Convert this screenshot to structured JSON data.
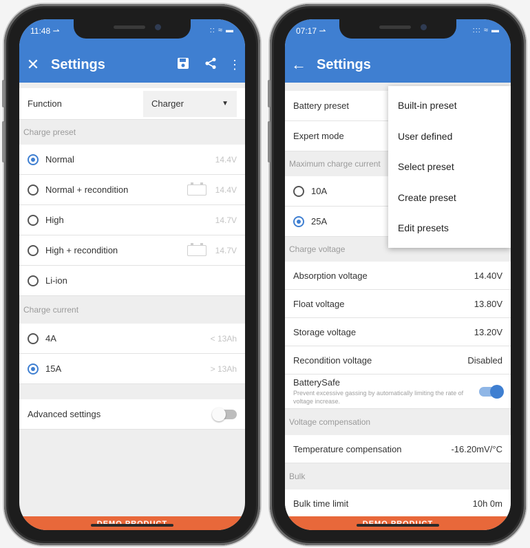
{
  "left": {
    "status": {
      "time": "11:48 ⇀",
      "icons": "::  ≈ ▬"
    },
    "title": "Settings",
    "function": {
      "label": "Function",
      "value": "Charger"
    },
    "charge_preset": {
      "header": "Charge preset",
      "items": [
        {
          "label": "Normal",
          "value": "14.4V",
          "selected": true,
          "battery": false
        },
        {
          "label": "Normal + recondition",
          "value": "14.4V",
          "selected": false,
          "battery": true
        },
        {
          "label": "High",
          "value": "14.7V",
          "selected": false,
          "battery": false
        },
        {
          "label": "High  + recondition",
          "value": "14.7V",
          "selected": false,
          "battery": true
        },
        {
          "label": "Li-ion",
          "value": "",
          "selected": false,
          "battery": false
        }
      ]
    },
    "charge_current": {
      "header": "Charge current",
      "items": [
        {
          "label": "4A",
          "value": "< 13Ah",
          "selected": false
        },
        {
          "label": "15A",
          "value": "> 13Ah",
          "selected": true
        }
      ]
    },
    "advanced": {
      "label": "Advanced settings",
      "enabled": false
    },
    "footer": "DEMO PRODUCT"
  },
  "right": {
    "status": {
      "time": "07:17 ⇀",
      "icons": "::: ≈ ▬"
    },
    "title": "Settings",
    "battery_preset": "Battery preset",
    "expert_mode": "Expert mode",
    "max_current": {
      "header": "Maximum charge current",
      "items": [
        {
          "label": "10A",
          "selected": false
        },
        {
          "label": "25A",
          "selected": true
        }
      ]
    },
    "charge_voltage": {
      "header": "Charge voltage",
      "absorption": {
        "label": "Absorption voltage",
        "value": "14.40V"
      },
      "float": {
        "label": "Float voltage",
        "value": "13.80V"
      },
      "storage": {
        "label": "Storage voltage",
        "value": "13.20V"
      },
      "recondition": {
        "label": "Recondition voltage",
        "value": "Disabled"
      },
      "batterysafe": {
        "label": "BatterySafe",
        "desc": "Prevent excessive gassing by automatically limiting the rate of voltage increase.",
        "enabled": true
      }
    },
    "voltage_comp": {
      "header": "Voltage compensation",
      "temp": {
        "label": "Temperature compensation",
        "value": "-16.20mV/°C"
      }
    },
    "bulk": {
      "header": "Bulk",
      "time_limit": {
        "label": "Bulk time limit",
        "value": "10h 0m"
      }
    },
    "menu": [
      "Built-in preset",
      "User defined",
      "Select preset",
      "Create preset",
      "Edit presets"
    ],
    "footer": "DEMO PRODUCT"
  },
  "colors": {
    "primary": "#3f7fd1",
    "footer": "#e8683a"
  }
}
